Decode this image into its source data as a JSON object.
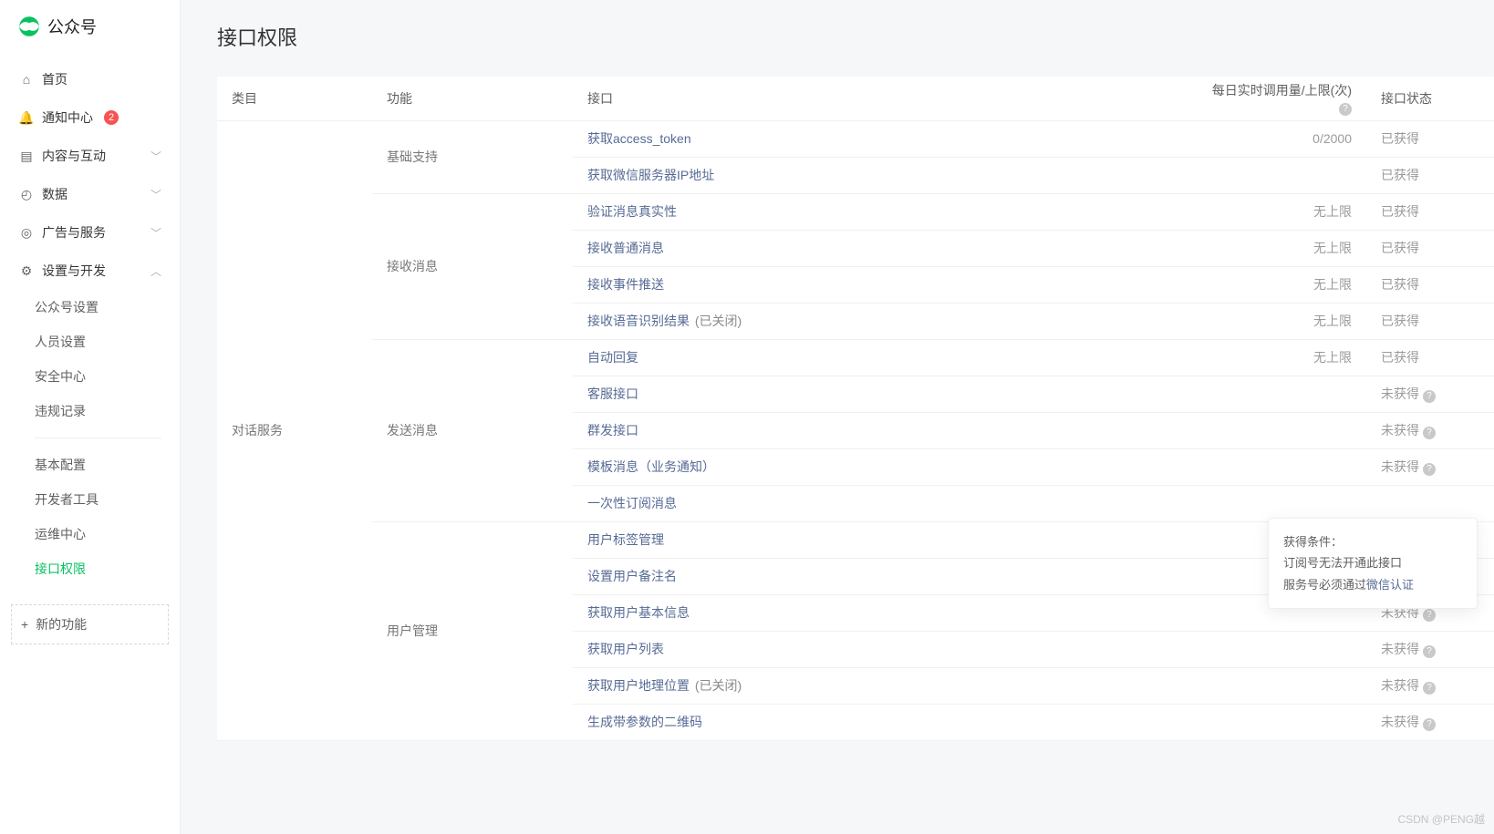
{
  "brand": {
    "name": "公众号"
  },
  "sidebar": {
    "home": "首页",
    "notice": "通知中心",
    "notice_badge": "2",
    "content": "内容与互动",
    "data": "数据",
    "ads": "广告与服务",
    "settings": "设置与开发",
    "sub": {
      "account": "公众号设置",
      "staff": "人员设置",
      "security": "安全中心",
      "violation": "违规记录",
      "basicconf": "基本配置",
      "devtools": "开发者工具",
      "ops": "运维中心",
      "apiperm": "接口权限"
    },
    "new_feature": "新的功能"
  },
  "page": {
    "title": "接口权限"
  },
  "columns": {
    "category": "类目",
    "function": "功能",
    "api": "接口",
    "quota": "每日实时调用量/上限(次)",
    "status": "接口状态"
  },
  "category": {
    "dialog": "对话服务"
  },
  "funcs": {
    "basic": "基础支持",
    "recv": "接收消息",
    "send": "发送消息",
    "user": "用户管理"
  },
  "status_labels": {
    "granted": "已获得",
    "not_granted": "未获得"
  },
  "quota_labels": {
    "unlimited": "无上限"
  },
  "api": {
    "access_token": "获取access_token",
    "server_ip": "获取微信服务器IP地址",
    "verify_msg": "验证消息真实性",
    "recv_normal": "接收普通消息",
    "recv_event": "接收事件推送",
    "recv_voice": "接收语音识别结果",
    "recv_voice_suffix": "(已关闭)",
    "auto_reply": "自动回复",
    "cs_api": "客服接口",
    "mass_send": "群发接口",
    "template_msg": "模板消息（业务通知）",
    "one_sub_msg": "一次性订阅消息",
    "user_tag": "用户标签管理",
    "user_remark": "设置用户备注名",
    "user_info": "获取用户基本信息",
    "user_list": "获取用户列表",
    "user_geo": "获取用户地理位置",
    "user_geo_suffix": "(已关闭)",
    "param_qr": "生成带参数的二维码"
  },
  "quota": {
    "access_token": "0/2000"
  },
  "tooltip": {
    "title": "获得条件：",
    "line1": "订阅号无法开通此接口",
    "line2_prefix": "服务号必须通过",
    "line2_link": "微信认证"
  },
  "watermark": "CSDN @PENG越"
}
